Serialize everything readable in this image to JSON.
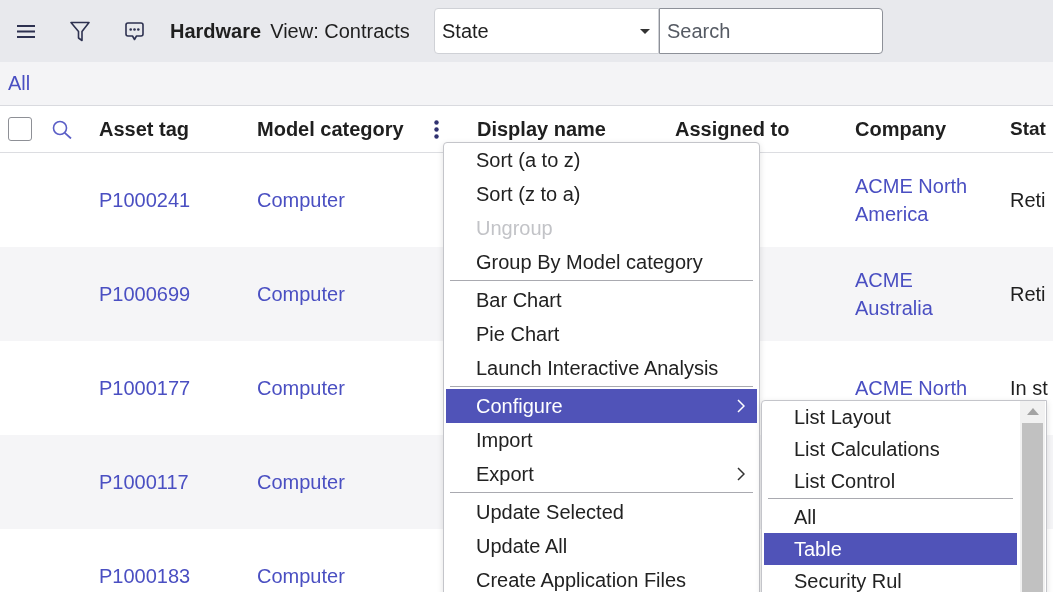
{
  "toolbar": {
    "title": "Hardware",
    "view": "View: Contracts",
    "field_select": {
      "value": "State"
    },
    "search": {
      "placeholder": "Search"
    }
  },
  "filter_bar": {
    "breadcrumb": "All"
  },
  "table": {
    "select_all": {
      "checked": false
    },
    "columns": [
      {
        "label": "Asset tag",
        "menu_button": false
      },
      {
        "label": "Model category",
        "menu_button": true
      },
      {
        "label": "Display name",
        "menu_button": false
      },
      {
        "label": "Assigned to",
        "menu_button": false
      },
      {
        "label": "Company",
        "menu_button": false
      },
      {
        "label": "Stat",
        "menu_button": false
      }
    ],
    "rows": [
      {
        "asset_tag": "P1000241",
        "model_category": "Computer",
        "company": "ACME North America",
        "column_6": "Reti"
      },
      {
        "asset_tag": "P1000699",
        "model_category": "Computer",
        "company": "ACME Australia",
        "column_6": "Reti"
      },
      {
        "asset_tag": "P1000177",
        "model_category": "Computer",
        "company": "ACME North",
        "column_6": "In st"
      },
      {
        "asset_tag": "P1000117",
        "model_category": "Computer"
      },
      {
        "asset_tag": "P1000183",
        "model_category": "Computer"
      }
    ]
  },
  "column_menu": {
    "groups": [
      [
        {
          "label": "Sort (a to z)",
          "disabled": false,
          "selected": false,
          "has_submenu": false
        },
        {
          "label": "Sort (z to a)",
          "disabled": false,
          "selected": false,
          "has_submenu": false
        },
        {
          "label": "Ungroup",
          "disabled": true,
          "selected": false,
          "has_submenu": false
        },
        {
          "label": "Group By Model category",
          "disabled": false,
          "selected": false,
          "has_submenu": false
        }
      ],
      [
        {
          "label": "Bar Chart",
          "disabled": false,
          "selected": false,
          "has_submenu": false
        },
        {
          "label": "Pie Chart",
          "disabled": false,
          "selected": false,
          "has_submenu": false
        },
        {
          "label": "Launch Interactive Analysis",
          "disabled": false,
          "selected": false,
          "has_submenu": false
        }
      ],
      [
        {
          "label": "Configure",
          "disabled": false,
          "selected": true,
          "has_submenu": true,
          "submenu_groups": [
            [
              {
                "label": "List Layout",
                "selected": false
              },
              {
                "label": "List Calculations",
                "selected": false
              },
              {
                "label": "List Control",
                "selected": false
              }
            ],
            [
              {
                "label": "All",
                "selected": false
              },
              {
                "label": "Table",
                "selected": true
              },
              {
                "label": "Security Rul",
                "selected": false
              }
            ]
          ]
        },
        {
          "label": "Import",
          "disabled": false,
          "selected": false,
          "has_submenu": false
        },
        {
          "label": "Export",
          "disabled": false,
          "selected": false,
          "has_submenu": true
        }
      ],
      [
        {
          "label": "Update Selected",
          "disabled": false,
          "selected": false,
          "has_submenu": false
        },
        {
          "label": "Update All",
          "disabled": false,
          "selected": false,
          "has_submenu": false
        },
        {
          "label": "Create Application Files",
          "disabled": false,
          "selected": false,
          "has_submenu": false
        }
      ]
    ]
  }
}
